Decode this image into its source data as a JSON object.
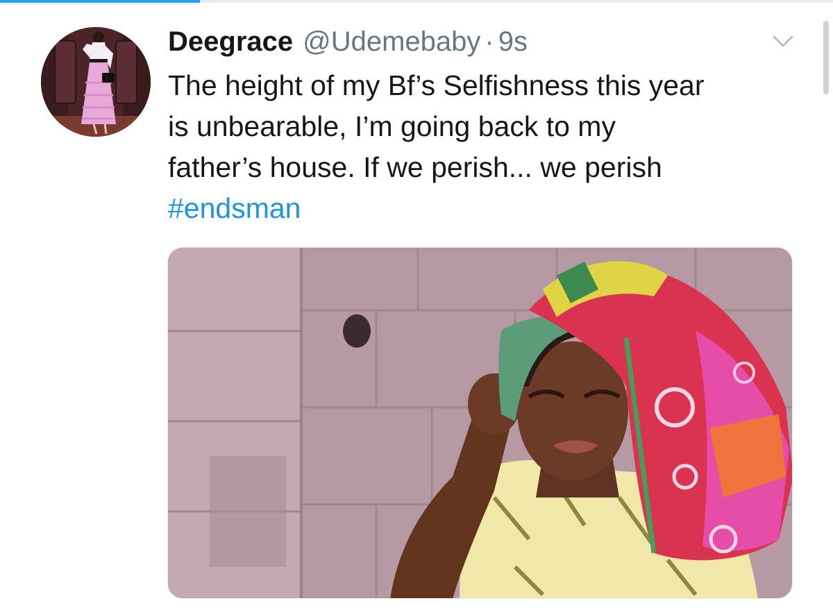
{
  "tweet": {
    "display_name": "Deegrace",
    "handle": "@Udemebaby",
    "separator": "·",
    "timestamp": "9s",
    "text_lines": [
      "The height of my Bf’s Selfishness this year",
      "is unbearable, I’m going back to my",
      "father’s house. If we perish... we perish"
    ],
    "hashtag": "#endsman"
  },
  "colors": {
    "accent": "#1da1f2",
    "hashtag": "#1b95e0",
    "secondary_text": "#657786",
    "primary_text": "#14171a"
  },
  "icons": {
    "menu_caret": "chevron-down-icon"
  },
  "progress": {
    "fraction": 0.24
  }
}
